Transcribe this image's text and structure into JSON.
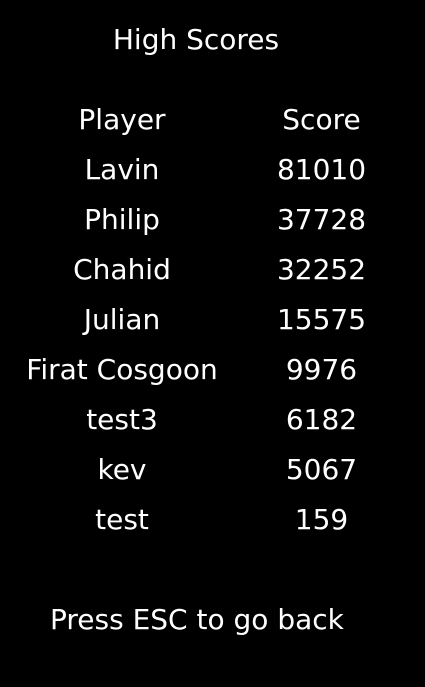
{
  "title": "High Scores",
  "table": {
    "headers": {
      "player": "Player",
      "score": "Score"
    },
    "rows": [
      {
        "player": "Lavin",
        "score": "81010"
      },
      {
        "player": "Philip",
        "score": "37728"
      },
      {
        "player": "Chahid",
        "score": "32252"
      },
      {
        "player": "Julian",
        "score": "15575"
      },
      {
        "player": "Firat Cosgoon",
        "score": "9976"
      },
      {
        "player": "test3",
        "score": "6182"
      },
      {
        "player": "kev",
        "score": "5067"
      },
      {
        "player": "test",
        "score": "159"
      }
    ]
  },
  "footer": "Press ESC to go back",
  "colors": {
    "background": "#000000",
    "text": "#ffffff"
  }
}
